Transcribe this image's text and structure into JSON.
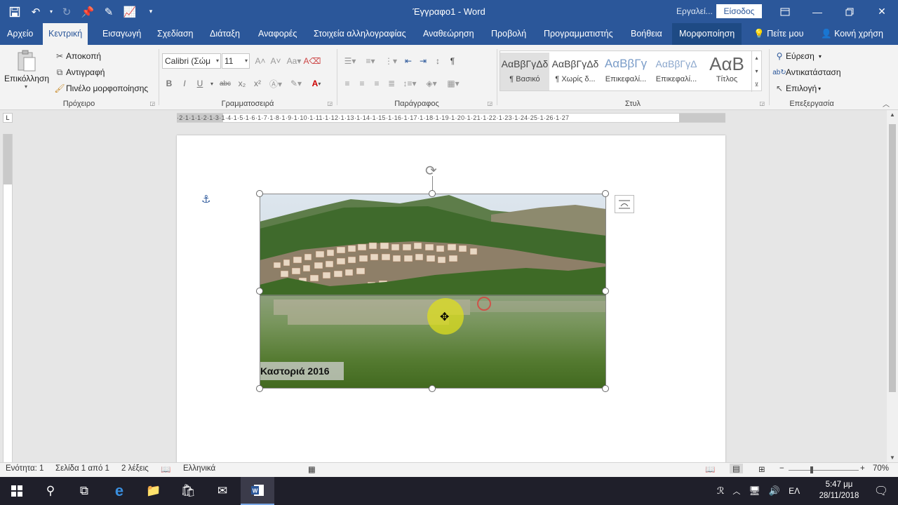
{
  "window": {
    "title": "Έγγραφο1 - Word",
    "tools_label": "Εργαλεί...",
    "signin": "Είσοδος"
  },
  "tabs": [
    "Αρχείο",
    "Κεντρική",
    "Εισαγωγή",
    "Σχεδίαση",
    "Διάταξη",
    "Αναφορές",
    "Στοιχεία αλληλογραφίας",
    "Αναθεώρηση",
    "Προβολή",
    "Προγραμματιστής",
    "Βοήθεια",
    "Μορφοποίηση"
  ],
  "tell_me": "Πείτε μου",
  "share": "Κοινή χρήση",
  "ribbon": {
    "clipboard": {
      "paste": "Επικόλληση",
      "cut": "Αποκοπή",
      "copy": "Αντιγραφή",
      "format_painter": "Πινέλο μορφοποίησης",
      "label": "Πρόχειρο"
    },
    "font": {
      "font_name": "Calibri (Σώμ",
      "font_size": "11",
      "bold": "B",
      "italic": "I",
      "underline": "U",
      "strike": "abc",
      "sub": "x₂",
      "sup": "x²",
      "label": "Γραμματοσειρά"
    },
    "paragraph": {
      "label": "Παράγραφος"
    },
    "styles": {
      "items": [
        {
          "preview": "ΑαΒβΓγΔδ",
          "name": "¶ Βασικό"
        },
        {
          "preview": "ΑαΒβΓγΔδ",
          "name": "¶ Χωρίς δ..."
        },
        {
          "preview": "ΑαΒβΓγ",
          "name": "Επικεφαλί..."
        },
        {
          "preview": "ΑαΒβΓγΔ",
          "name": "Επικεφαλί..."
        },
        {
          "preview": "ΑαΒ",
          "name": "Τίτλος"
        }
      ],
      "label": "Στυλ"
    },
    "editing": {
      "find": "Εύρεση",
      "replace": "Αντικατάσταση",
      "select": "Επιλογή",
      "label": "Επεξεργασία"
    }
  },
  "ruler": {
    "h_numbers": "·2·1·1·1·2·1·3·1·4·1·5·1·6·1·7·1·8·1·9·1·10·1·11·1·12·1·13·1·14·1·15·1·16·1·17·1·18·1·19·1·20·1·21·1·22·1·23·1·24·25·1·26·1·27",
    "corner": "L"
  },
  "document": {
    "caption": "Καστοριά 2016"
  },
  "status": {
    "section": "Ενότητα: 1",
    "page": "Σελίδα 1 από 1",
    "words": "2 λέξεις",
    "language": "Ελληνικά",
    "zoom": "70%",
    "zoom_value": 70
  },
  "taskbar": {
    "lang": "ΕΛ",
    "time": "5:47 μμ",
    "date": "28/11/2018"
  }
}
